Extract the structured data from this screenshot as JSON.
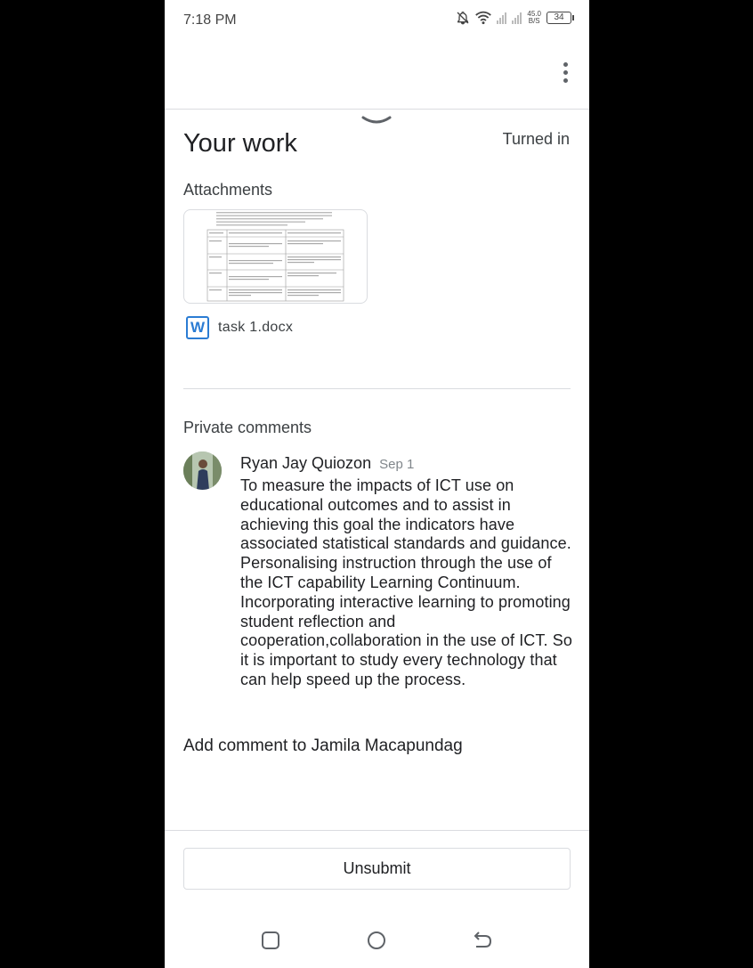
{
  "status_bar": {
    "time": "7:18 PM",
    "net_speed_value": "45.0",
    "net_speed_unit": "B/S",
    "battery": "34"
  },
  "work": {
    "title": "Your work",
    "status": "Turned in"
  },
  "attachments": {
    "heading": "Attachments",
    "files": [
      {
        "name": "task 1.docx",
        "icon": "word-icon",
        "icon_letter": "W"
      }
    ]
  },
  "comments": {
    "heading": "Private comments",
    "items": [
      {
        "author": "Ryan Jay Quiozon",
        "date": "Sep 1",
        "text": "To measure the impacts of ICT use on educational outcomes and to assist in achieving this goal the indicators have associated statistical standards and guidance. Personalising instruction through the use of the ICT capability Learning Continuum. Incorporating interactive learning to promoting student reflection and cooperation,collaboration in the use of ICT. So it is important to study every technology that can help speed up the process."
      }
    ],
    "add_placeholder": "Add comment to Jamila Macapundag"
  },
  "actions": {
    "unsubmit_label": "Unsubmit"
  },
  "colors": {
    "accent_word": "#2b7cd3",
    "divider": "#dadce0",
    "text_primary": "#202124",
    "text_secondary": "#3c4043"
  }
}
